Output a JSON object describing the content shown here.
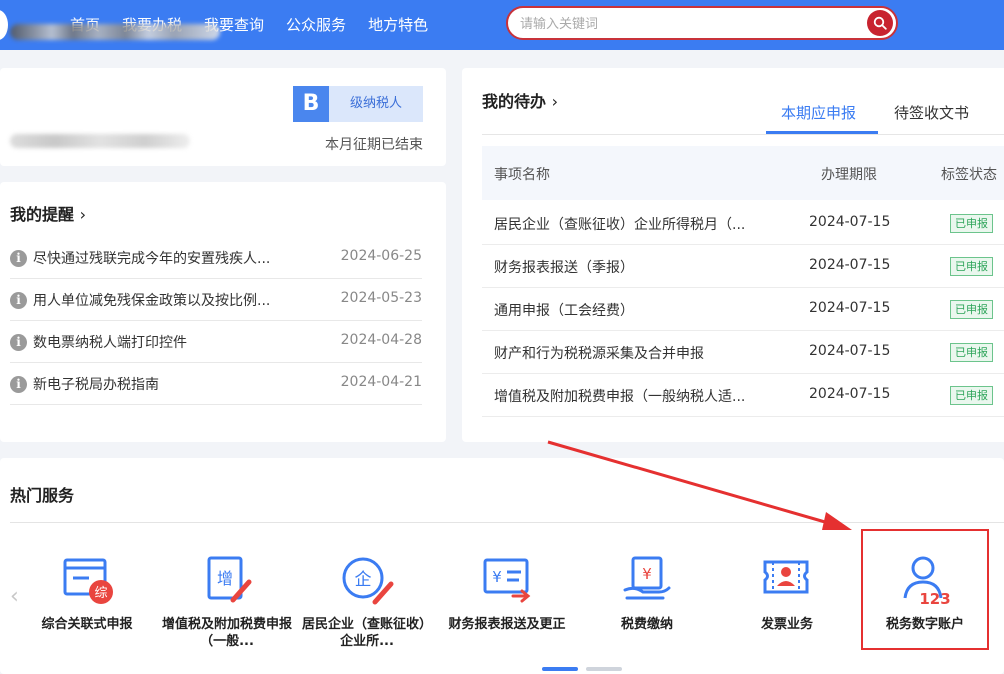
{
  "nav": {
    "items": [
      "首页",
      "我要办税",
      "我要查询",
      "公众服务",
      "地方特色"
    ]
  },
  "search": {
    "placeholder": "请输入关键词"
  },
  "taxpayer": {
    "badge_letter": "B",
    "badge_label": "级纳税人",
    "period_status": "本月征期已结束"
  },
  "reminders": {
    "title": "我的提醒",
    "items": [
      {
        "text": "尽快通过残联完成今年的安置残疾人...",
        "date": "2024-06-25"
      },
      {
        "text": "用人单位减免残保金政策以及按比例...",
        "date": "2024-05-23"
      },
      {
        "text": "数电票纳税人端打印控件",
        "date": "2024-04-28"
      },
      {
        "text": "新电子税局办税指南",
        "date": "2024-04-21"
      }
    ]
  },
  "todo": {
    "title": "我的待办",
    "tabs": [
      "本期应申报",
      "待签收文书"
    ],
    "active_tab": "本期应申报",
    "columns": [
      "事项名称",
      "办理期限",
      "标签状态"
    ],
    "rows": [
      {
        "name": "居民企业（查账征收）企业所得税月（...",
        "deadline": "2024-07-15",
        "status": "已申报"
      },
      {
        "name": "财务报表报送（季报）",
        "deadline": "2024-07-15",
        "status": "已申报"
      },
      {
        "name": "通用申报（工会经费）",
        "deadline": "2024-07-15",
        "status": "已申报"
      },
      {
        "name": "财产和行为税税源采集及合并申报",
        "deadline": "2024-07-15",
        "status": "已申报"
      },
      {
        "name": "增值税及附加税费申报（一般纳税人适...",
        "deadline": "2024-07-15",
        "status": "已申报"
      }
    ]
  },
  "hot_services": {
    "title": "热门服务",
    "items": [
      {
        "label": "综合关联式申报",
        "icon": "comprehensive-declare-icon",
        "icon_badge": "综"
      },
      {
        "label": "增值税及附加税费申报（一般...",
        "icon": "vat-declare-icon",
        "icon_badge": "增"
      },
      {
        "label": "居民企业（查账征收）企业所...",
        "icon": "enterprise-income-icon",
        "icon_badge": "企"
      },
      {
        "label": "财务报表报送及更正",
        "icon": "financial-report-icon",
        "icon_badge": "¥"
      },
      {
        "label": "税费缴纳",
        "icon": "tax-payment-icon",
        "icon_badge": "¥"
      },
      {
        "label": "发票业务",
        "icon": "invoice-icon",
        "icon_badge": ""
      },
      {
        "label": "税务数字账户",
        "icon": "digital-account-icon",
        "icon_badge": "123"
      }
    ],
    "pagination_pages": 2,
    "active_page": 1
  },
  "colors": {
    "primary": "#3b7cf2",
    "accent_red": "#e53030",
    "status_green": "#2ea55a"
  }
}
